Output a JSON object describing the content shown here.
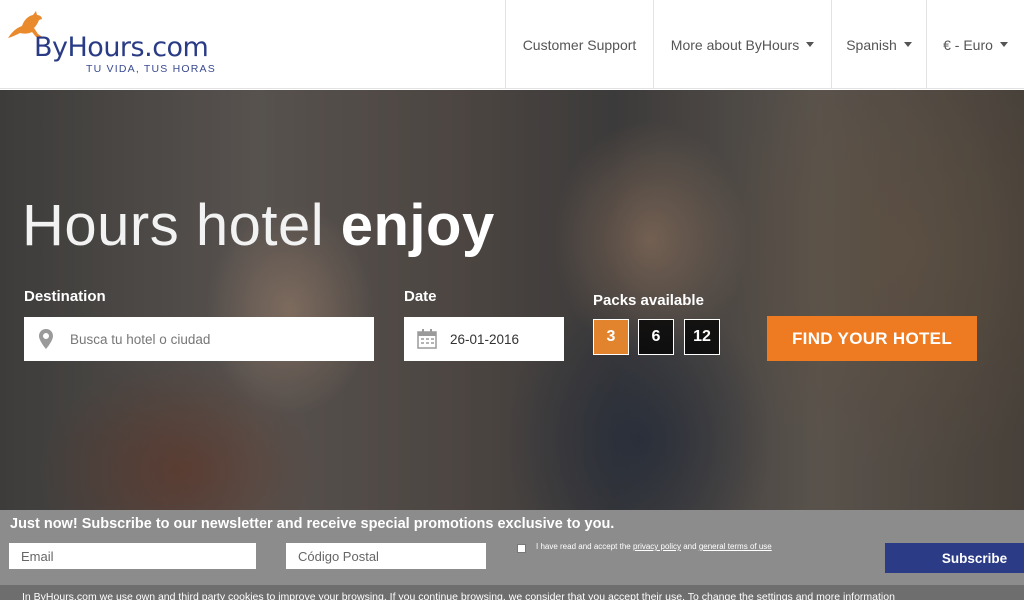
{
  "logo": {
    "brand_bold": "ByHours",
    "brand_light": ".com",
    "tagline": "TU VIDA, TUS HORAS",
    "mark_color": "#e98a2c",
    "brand_color": "#2a3b86"
  },
  "nav": {
    "items": [
      {
        "label": "Customer Support",
        "has_caret": false
      },
      {
        "label": "More about ByHours",
        "has_caret": true
      },
      {
        "label": "Spanish",
        "has_caret": true
      },
      {
        "label": "€ - Euro",
        "has_caret": true
      }
    ]
  },
  "hero": {
    "title_light": "Hours hotel",
    "title_bold": "enjoy",
    "destination_label": "Destination",
    "destination_placeholder": "Busca tu hotel o ciudad",
    "date_label": "Date",
    "date_value": "26-01-2016",
    "packs_label": "Packs available",
    "packs": [
      "3",
      "6",
      "12"
    ],
    "active_pack": "3",
    "find_button": "FIND YOUR HOTEL",
    "accent_color": "#ee7b22"
  },
  "newsletter": {
    "title": "Just now! Subscribe to our newsletter and receive special promotions exclusive to you.",
    "email_placeholder": "Email",
    "postal_placeholder": "Código Postal",
    "terms_prefix": "I have read and accept the",
    "privacy_link": "privacy policy",
    "terms_and": "and",
    "terms_link": "general terms of use",
    "subscribe_button": "Subscribe",
    "button_color": "#2b3b86"
  },
  "cookie": {
    "text": "In ByHours.com we use own and third party cookies to improve your browsing. If you continue browsing, we consider that you accept their use. To change the settings and more information"
  }
}
